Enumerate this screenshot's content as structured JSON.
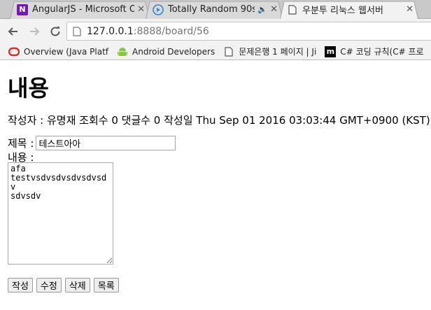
{
  "browser": {
    "tabs": [
      {
        "title": "AngularJS - Microsoft O",
        "favicon": "onenote-icon",
        "active": false
      },
      {
        "title": "Totally Random 90s (",
        "favicon": "play-icon",
        "active": false,
        "audio": "🔈"
      },
      {
        "title": "우분투 리눅스 웹서버",
        "favicon": "page-icon",
        "active": true
      }
    ],
    "tab_close": "✕",
    "url_host": "127.0.0.1",
    "url_path": ":8888/board/56",
    "bookmarks": [
      {
        "label": "Overview (Java Platf",
        "icon": "java-icon"
      },
      {
        "label": "Android Developers",
        "icon": "android-icon"
      },
      {
        "label": "문제은행 1 페이지 | Ji",
        "icon": "page-icon"
      },
      {
        "label": "C# 코딩 규칙(C# 프로",
        "icon": "microsoft-icon"
      }
    ]
  },
  "page": {
    "title": "내용",
    "meta": "작성자 : 유명재 조회수 0 댓글수 0 작성일 Thu Sep 01 2016 03:03:44 GMT+0900 (KST)",
    "subject_label": "제목 :",
    "subject_value": "테스트아아",
    "content_label": "내용 :",
    "content_value": "afa\ntestvsdvsdvsdvsdvsdv\nsdvsdv",
    "buttons": {
      "write": "작성",
      "edit": "수정",
      "delete": "삭제",
      "list": "목록"
    }
  },
  "colors": {
    "onenote": "#7719aa",
    "java_bookmark": "#d32f2f",
    "android": "#8bc34a"
  }
}
